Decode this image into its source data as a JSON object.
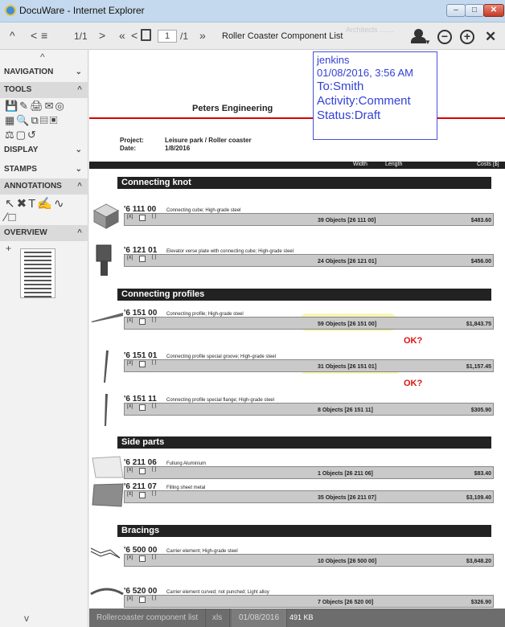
{
  "window": {
    "title": "DocuWare - Internet Explorer",
    "min": "–",
    "max": "□",
    "close": "✕"
  },
  "toolbar": {
    "up": "^",
    "prev": "<",
    "layers": "≡",
    "layer_count": "1/1",
    "next": ">",
    "first": "«",
    "prev_page": "<",
    "page_input": "1",
    "page_total": "/1",
    "last": "»",
    "doc_title": "Roller Coaster Component List",
    "ghost_tab": "Architects  .......",
    "zoom_out": "−",
    "zoom_in": "+",
    "close": "✕"
  },
  "sidebar": {
    "up": "^",
    "navigation": "NAVIGATION",
    "tools": "TOOLS",
    "tool_row1": "💾✎🖨✉◎",
    "tool_row2": "▦🔍⧉▤▣",
    "tool_row3": "⚖▢↺",
    "display": "DISPLAY",
    "stamps": "STAMPS",
    "annotations": "ANNOTATIONS",
    "ann_row1": "↖✖T✍∿",
    "ann_row2": "∕□",
    "overview": "OVERVIEW",
    "overview_plus": "+",
    "down": "v",
    "chev_down": "⌄",
    "chev_up": "^"
  },
  "document": {
    "company": "Peters Engineering",
    "project_label": "Project:",
    "project_value": "Leisure park / Roller coaster",
    "date_label": "Date:",
    "date_value": "1/8/2016",
    "col_width": "Width",
    "col_length": "Length",
    "col_costs": "Costs [$]",
    "sections": [
      {
        "title": "Connecting knot"
      },
      {
        "title": "Connecting profiles"
      },
      {
        "title": "Side parts"
      },
      {
        "title": "Bracings"
      }
    ],
    "items": [
      {
        "num": "'6 111 00",
        "desc": "Connecting cube; High-grade steel",
        "objects": "39 Objects  [26 111 00]",
        "cost": "$483.60"
      },
      {
        "num": "'6 121 01",
        "desc": "Elevator verse plate with connecting cube; High-grade steel",
        "objects": "24 Objects  [26 121 01]",
        "cost": "$456.00"
      },
      {
        "num": "'6 151 00",
        "desc": "Connecting profile; High-grade steel",
        "objects": "59 Objects  [26 151 00]",
        "cost": "$1,843.75"
      },
      {
        "num": "'6 151 01",
        "desc": "Connecting profile special groove; High-grade steel",
        "objects": "31 Objects  [26 151 01]",
        "cost": "$1,157.45"
      },
      {
        "num": "'6 151 11",
        "desc": "Connecting profile special flange; High-grade steel",
        "objects": "8 Objects  [26 151 11]",
        "cost": "$305.90"
      },
      {
        "num": "'6 211 06",
        "desc": "Fullung Aluminium",
        "objects": "1 Objects  [26 211 06]",
        "cost": "$83.40"
      },
      {
        "num": "'6 211 07",
        "desc": "Filling sheet metal",
        "objects": "35 Objects  [26 211 07]",
        "cost": "$3,109.40"
      },
      {
        "num": "'6 500 00",
        "desc": "Carrier element; High-grade steel",
        "objects": "10 Objects  [26 500 00]",
        "cost": "$3,648.20"
      },
      {
        "num": "'6 520 00",
        "desc": "Carrier element curved; not punched; Light alloy",
        "objects": "7 Objects  [26 520 00]",
        "cost": "$326.90"
      }
    ],
    "check_label": "[X]",
    "bracket": "[ ]",
    "ok_marks": [
      "OK?",
      "OK?"
    ]
  },
  "annotation": {
    "user": "jenkins",
    "timestamp": "01/08/2016, 3:56 AM",
    "to": "To:Smith",
    "activity": "Activity:Comment",
    "status": "Status:Draft",
    "color": "#3340d8"
  },
  "statusbar": {
    "doc_name": "Rollercoaster component list",
    "type": "xls",
    "date": "01/08/2016",
    "size": "491 KB"
  }
}
